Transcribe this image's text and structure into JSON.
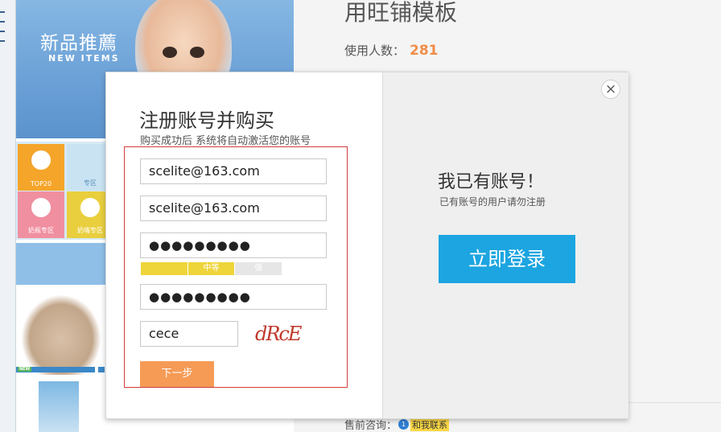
{
  "background": {
    "hero_title": "新品推薦",
    "hero_subtitle": "NEW ITEMS",
    "template_title": "用旺铺模板",
    "users_label": "使用人数：",
    "users_count": "281",
    "consult_label": "售前咨询：",
    "contact_label": "和我联系",
    "tiles": [
      {
        "label": "TOP20",
        "color": "#f4a52a"
      },
      {
        "label": "奶瓶专区",
        "color": "#f08fa0"
      },
      {
        "label": "奶嘴专区",
        "color": "#e9cf3e"
      },
      {
        "label": "专区",
        "color": "#c9e3f3"
      }
    ],
    "product_tag": "NEW"
  },
  "modal": {
    "close_glyph": "×",
    "register": {
      "title": "注册账号并购买",
      "subtitle": "购买成功后 系统将自动激活您的账号",
      "email": "scelite@163.com",
      "email_confirm": "scelite@163.com",
      "password_mask": "●●●●●●●●●",
      "password_confirm_mask": "●●●●●●●●●",
      "strength_levels": [
        "",
        "中等",
        "强"
      ],
      "captcha_value": "cece",
      "captcha_image_text": "dRcE",
      "next_button": "下一步"
    },
    "login": {
      "title": "我已有账号！",
      "subtitle": "已有账号的用户请勿注册",
      "login_button": "立即登录"
    }
  },
  "colors": {
    "accent_orange": "#f59b56",
    "login_blue": "#1ca5e0",
    "form_border_red": "#d23c3c",
    "strength_yellow": "#eed53a"
  }
}
